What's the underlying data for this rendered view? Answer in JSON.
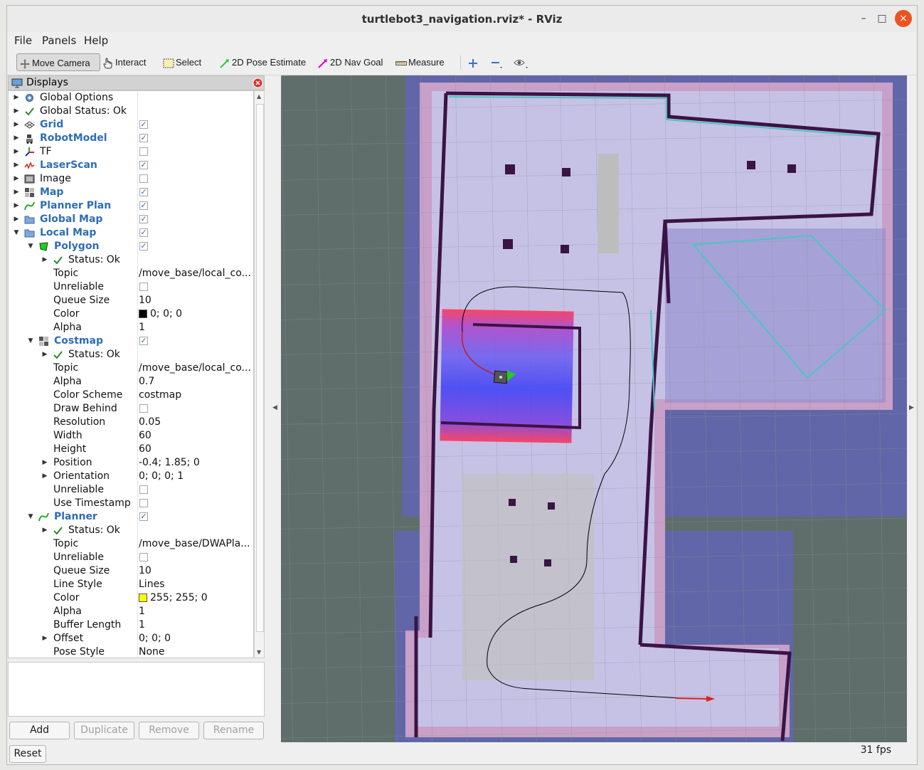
{
  "window": {
    "title": "turtlebot3_navigation.rviz* - RViz",
    "minimize": "–",
    "maximize": "□",
    "close": "×"
  },
  "menu": {
    "file": "File",
    "panels": "Panels",
    "help": "Help"
  },
  "toolbar": {
    "move_camera": "Move Camera",
    "interact": "Interact",
    "select": "Select",
    "pose_estimate": "2D Pose Estimate",
    "nav_goal": "2D Nav Goal",
    "measure": "Measure"
  },
  "displays": {
    "title": "Displays",
    "rows": [
      {
        "label": "Global Options",
        "value": "",
        "checkbox": null
      },
      {
        "label": "Global Status: Ok",
        "value": "",
        "checkbox": null
      },
      {
        "label": "Grid",
        "value": "",
        "checkbox": true
      },
      {
        "label": "RobotModel",
        "value": "",
        "checkbox": true
      },
      {
        "label": "TF",
        "value": "",
        "checkbox": false
      },
      {
        "label": "LaserScan",
        "value": "",
        "checkbox": true
      },
      {
        "label": "Image",
        "value": "",
        "checkbox": false
      },
      {
        "label": "Map",
        "value": "",
        "checkbox": true
      },
      {
        "label": "Planner Plan",
        "value": "",
        "checkbox": true
      },
      {
        "label": "Global Map",
        "value": "",
        "checkbox": true
      },
      {
        "label": "Local Map",
        "value": "",
        "checkbox": true
      },
      {
        "label": "Polygon",
        "value": "",
        "checkbox": true
      },
      {
        "label": "Status: Ok",
        "value": "",
        "checkbox": null
      },
      {
        "label": "Topic",
        "value": "/move_base/local_co...",
        "checkbox": null
      },
      {
        "label": "Unreliable",
        "value": "",
        "checkbox": false
      },
      {
        "label": "Queue Size",
        "value": "10",
        "checkbox": null
      },
      {
        "label": "Color",
        "value": "0; 0; 0",
        "checkbox": null,
        "swatch": "#000000"
      },
      {
        "label": "Alpha",
        "value": "1",
        "checkbox": null
      },
      {
        "label": "Costmap",
        "value": "",
        "checkbox": true
      },
      {
        "label": "Status: Ok",
        "value": "",
        "checkbox": null
      },
      {
        "label": "Topic",
        "value": "/move_base/local_co...",
        "checkbox": null
      },
      {
        "label": "Alpha",
        "value": "0.7",
        "checkbox": null
      },
      {
        "label": "Color Scheme",
        "value": "costmap",
        "checkbox": null
      },
      {
        "label": "Draw Behind",
        "value": "",
        "checkbox": false
      },
      {
        "label": "Resolution",
        "value": "0.05",
        "checkbox": null
      },
      {
        "label": "Width",
        "value": "60",
        "checkbox": null
      },
      {
        "label": "Height",
        "value": "60",
        "checkbox": null
      },
      {
        "label": "Position",
        "value": "-0.4; 1.85; 0",
        "checkbox": null
      },
      {
        "label": "Orientation",
        "value": "0; 0; 0; 1",
        "checkbox": null
      },
      {
        "label": "Unreliable",
        "value": "",
        "checkbox": false
      },
      {
        "label": "Use Timestamp",
        "value": "",
        "checkbox": false
      },
      {
        "label": "Planner",
        "value": "",
        "checkbox": true
      },
      {
        "label": "Status: Ok",
        "value": "",
        "checkbox": null
      },
      {
        "label": "Topic",
        "value": "/move_base/DWAPla...",
        "checkbox": null
      },
      {
        "label": "Unreliable",
        "value": "",
        "checkbox": false
      },
      {
        "label": "Queue Size",
        "value": "10",
        "checkbox": null
      },
      {
        "label": "Line Style",
        "value": "Lines",
        "checkbox": null
      },
      {
        "label": "Color",
        "value": "255; 255; 0",
        "checkbox": null,
        "swatch": "#ffff00"
      },
      {
        "label": "Alpha",
        "value": "1",
        "checkbox": null
      },
      {
        "label": "Buffer Length",
        "value": "1",
        "checkbox": null
      },
      {
        "label": "Offset",
        "value": "0; 0; 0",
        "checkbox": null
      },
      {
        "label": "Pose Style",
        "value": "None",
        "checkbox": null
      }
    ]
  },
  "buttons": {
    "add": "Add",
    "duplicate": "Duplicate",
    "remove": "Remove",
    "rename": "Rename",
    "reset": "Reset"
  },
  "status": {
    "fps": "31 fps"
  },
  "colors": {
    "accent": "#2e6db8",
    "close": "#e95420",
    "viewport_bg": "#5f6e6b"
  }
}
